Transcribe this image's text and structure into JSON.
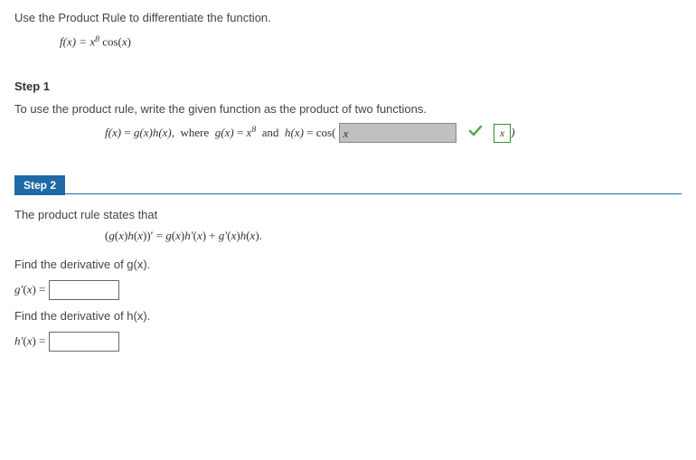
{
  "prompt": "Use the Product Rule to differentiate the function.",
  "given_fn_lhs": "f(x) = x",
  "given_fn_exp": "8",
  "given_fn_rhs": " cos(x)",
  "step1": {
    "title": "Step 1",
    "text": "To use the product rule, write the given function as the product of two functions.",
    "expr_a": "f(x) = g(x)h(x),  where  g(x) = x",
    "expr_exp": "8",
    "expr_b": "  and  h(x) = cos(",
    "input_value": "x",
    "expr_close": ")",
    "correct_answer": "x"
  },
  "step2": {
    "title": "Step 2",
    "line1": "The product rule states that",
    "rule": "(g(x)h(x))′ = g(x)h′(x) + g′(x)h(x).",
    "find_g": "Find the derivative of g(x).",
    "g_label": "g′(x) =",
    "find_h": "Find the derivative of h(x).",
    "h_label": "h′(x) ="
  },
  "chart_data": null
}
